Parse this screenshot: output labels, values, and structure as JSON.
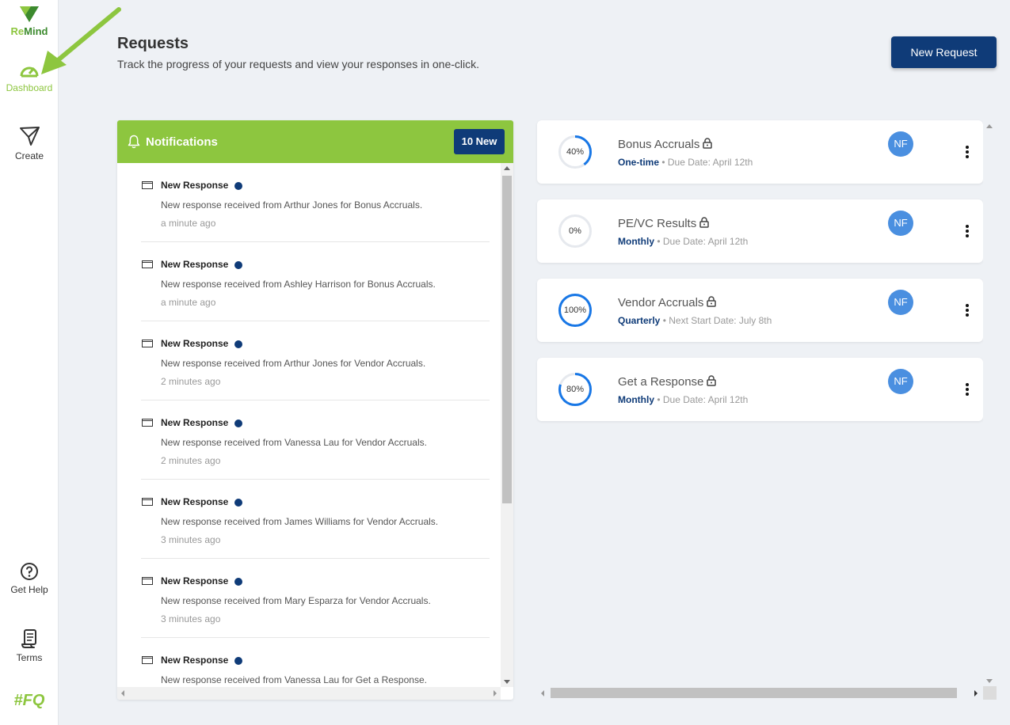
{
  "brand": {
    "logo_text_re": "Re",
    "logo_text_mind": "Mind",
    "footer_logo": "#FQ",
    "accent": "#8dc63f",
    "primary": "#0f3b78"
  },
  "sidebar": {
    "items": [
      {
        "label": "Dashboard",
        "icon": "gauge-icon",
        "active": true
      },
      {
        "label": "Create",
        "icon": "paper-plane-icon"
      },
      {
        "label": "Get Help",
        "icon": "question-circle-icon"
      },
      {
        "label": "Terms",
        "icon": "scroll-icon"
      }
    ]
  },
  "header": {
    "title": "Requests",
    "subtitle": "Track the progress of your requests and view your responses in one-click.",
    "new_request_label": "New Request"
  },
  "notifications": {
    "title": "Notifications",
    "badge": "10 New",
    "items": [
      {
        "title": "New Response",
        "message": "New response received from Arthur Jones for Bonus Accruals.",
        "time": "a minute ago"
      },
      {
        "title": "New Response",
        "message": "New response received from Ashley Harrison for Bonus Accruals.",
        "time": "a minute ago"
      },
      {
        "title": "New Response",
        "message": "New response received from Arthur Jones for Vendor Accruals.",
        "time": "2 minutes ago"
      },
      {
        "title": "New Response",
        "message": "New response received from Vanessa Lau for Vendor Accruals.",
        "time": "2 minutes ago"
      },
      {
        "title": "New Response",
        "message": "New response received from James Williams for Vendor Accruals.",
        "time": "3 minutes ago"
      },
      {
        "title": "New Response",
        "message": "New response received from Mary Esparza for Vendor Accruals.",
        "time": "3 minutes ago"
      },
      {
        "title": "New Response",
        "message": "New response received from Vanessa Lau for Get a Response.",
        "time": ""
      }
    ]
  },
  "requests": [
    {
      "title": "Bonus Accruals",
      "progress": 40,
      "progress_label": "40%",
      "frequency": "One-time",
      "date_label": "Due Date: April 12th",
      "avatar": "NF"
    },
    {
      "title": "PE/VC Results",
      "progress": 0,
      "progress_label": "0%",
      "frequency": "Monthly",
      "date_label": "Due Date: April 12th",
      "avatar": "NF"
    },
    {
      "title": "Vendor Accruals",
      "progress": 100,
      "progress_label": "100%",
      "frequency": "Quarterly",
      "date_label": "Next Start Date: July 8th",
      "avatar": "NF"
    },
    {
      "title": "Get a Response",
      "progress": 80,
      "progress_label": "80%",
      "frequency": "Monthly",
      "date_label": "Due Date: April 12th",
      "avatar": "NF"
    }
  ]
}
